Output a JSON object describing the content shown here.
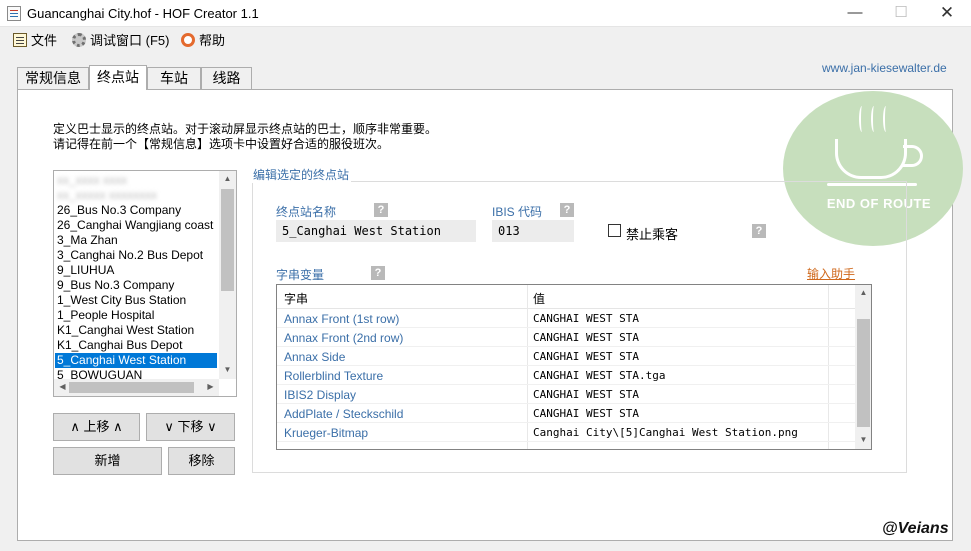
{
  "window": {
    "title": "Guancanghai City.hof - HOF Creator 1.1",
    "minimize": "—",
    "maximize": "☐",
    "close": "✕"
  },
  "menu": {
    "file": "文件",
    "debug": "调试窗口 (F5)",
    "help": "帮助",
    "website": "www.jan-kiesewalter.de"
  },
  "tabs": [
    {
      "label": "常规信息"
    },
    {
      "label": "终点站",
      "active": true
    },
    {
      "label": "车站"
    },
    {
      "label": "线路"
    }
  ],
  "logo": {
    "text": "END OF ROUTE"
  },
  "instructions": {
    "line1": "定义巴士显示的终点站。对于滚动屏显示终点站的巴士，顺序非常重要。",
    "line2": "请记得在前一个【常规信息】选项卡中设置好合适的服役班次。"
  },
  "terminus_list": {
    "items": [
      "26_Bus No.3 Company",
      "26_Canghai Wangjiang coast",
      "3_Ma Zhan",
      "3_Canghai No.2 Bus Depot",
      "9_LIUHUA",
      "9_Bus No.3 Company",
      "1_West City Bus Station",
      "1_People Hospital",
      "K1_Canghai West Station",
      "K1_Canghai Bus Depot",
      "5_Canghai West Station",
      "5_BOWUGUAN"
    ],
    "selected": "5_Canghai West Station"
  },
  "buttons": {
    "up": "∧  上移  ∧",
    "down": "∨  下移  ∨",
    "add": "新增",
    "remove": "移除"
  },
  "editor": {
    "group_title": "编辑选定的终点站",
    "name_label": "终点站名称",
    "name_value": "5_Canghai West Station",
    "ibis_label": "IBIS 代码",
    "ibis_value": "013",
    "no_passenger_label": "禁止乘客",
    "no_passenger_checked": false,
    "string_vars_label": "字串变量",
    "input_assist": "输入助手",
    "help_mark": "?"
  },
  "string_table": {
    "columns": [
      "字串",
      "值"
    ],
    "rows": [
      {
        "key": "Annax Front (1st row)",
        "value": "CANGHAI WEST STA"
      },
      {
        "key": "Annax Front (2nd row)",
        "value": "CANGHAI WEST STA"
      },
      {
        "key": "Annax Side",
        "value": "CANGHAI WEST STA"
      },
      {
        "key": "Rollerblind Texture",
        "value": "CANGHAI WEST STA.tga"
      },
      {
        "key": "IBIS2 Display",
        "value": "CANGHAI WEST STA"
      },
      {
        "key": "AddPlate / Steckschild",
        "value": "CANGHAI WEST STA"
      },
      {
        "key": "Krueger-Bitmap",
        "value": "Canghai City\\[5]Canghai West Station.png"
      }
    ]
  },
  "watermark": "@Veians"
}
